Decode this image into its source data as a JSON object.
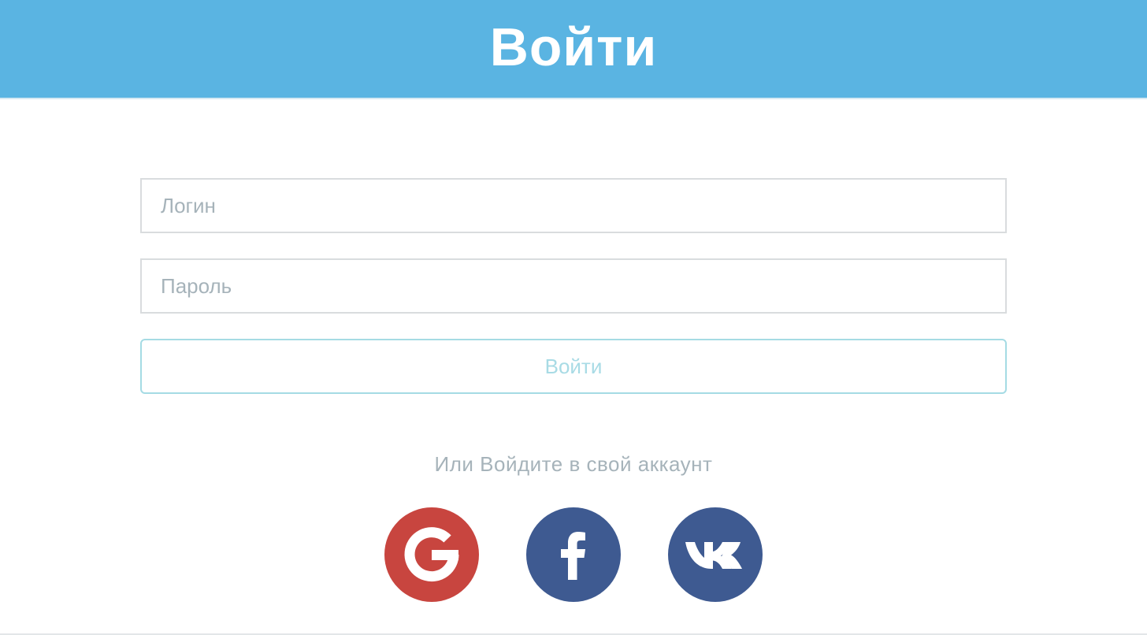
{
  "header": {
    "title": "Войти"
  },
  "form": {
    "login_placeholder": "Логин",
    "password_placeholder": "Пароль",
    "submit_label": "Войти"
  },
  "alt_login": {
    "text": "Или Войдите в свой аккаунт"
  },
  "social": [
    {
      "name": "google",
      "icon": "google-icon",
      "color": "#c8453f"
    },
    {
      "name": "facebook",
      "icon": "facebook-icon",
      "color": "#3e5a91"
    },
    {
      "name": "vk",
      "icon": "vk-icon",
      "color": "#3e5a91"
    }
  ],
  "colors": {
    "header_bg": "#5ab4e2",
    "input_border": "#d9dcde",
    "submit_border": "#a5dbe4",
    "muted_text": "#a6b3ba"
  }
}
